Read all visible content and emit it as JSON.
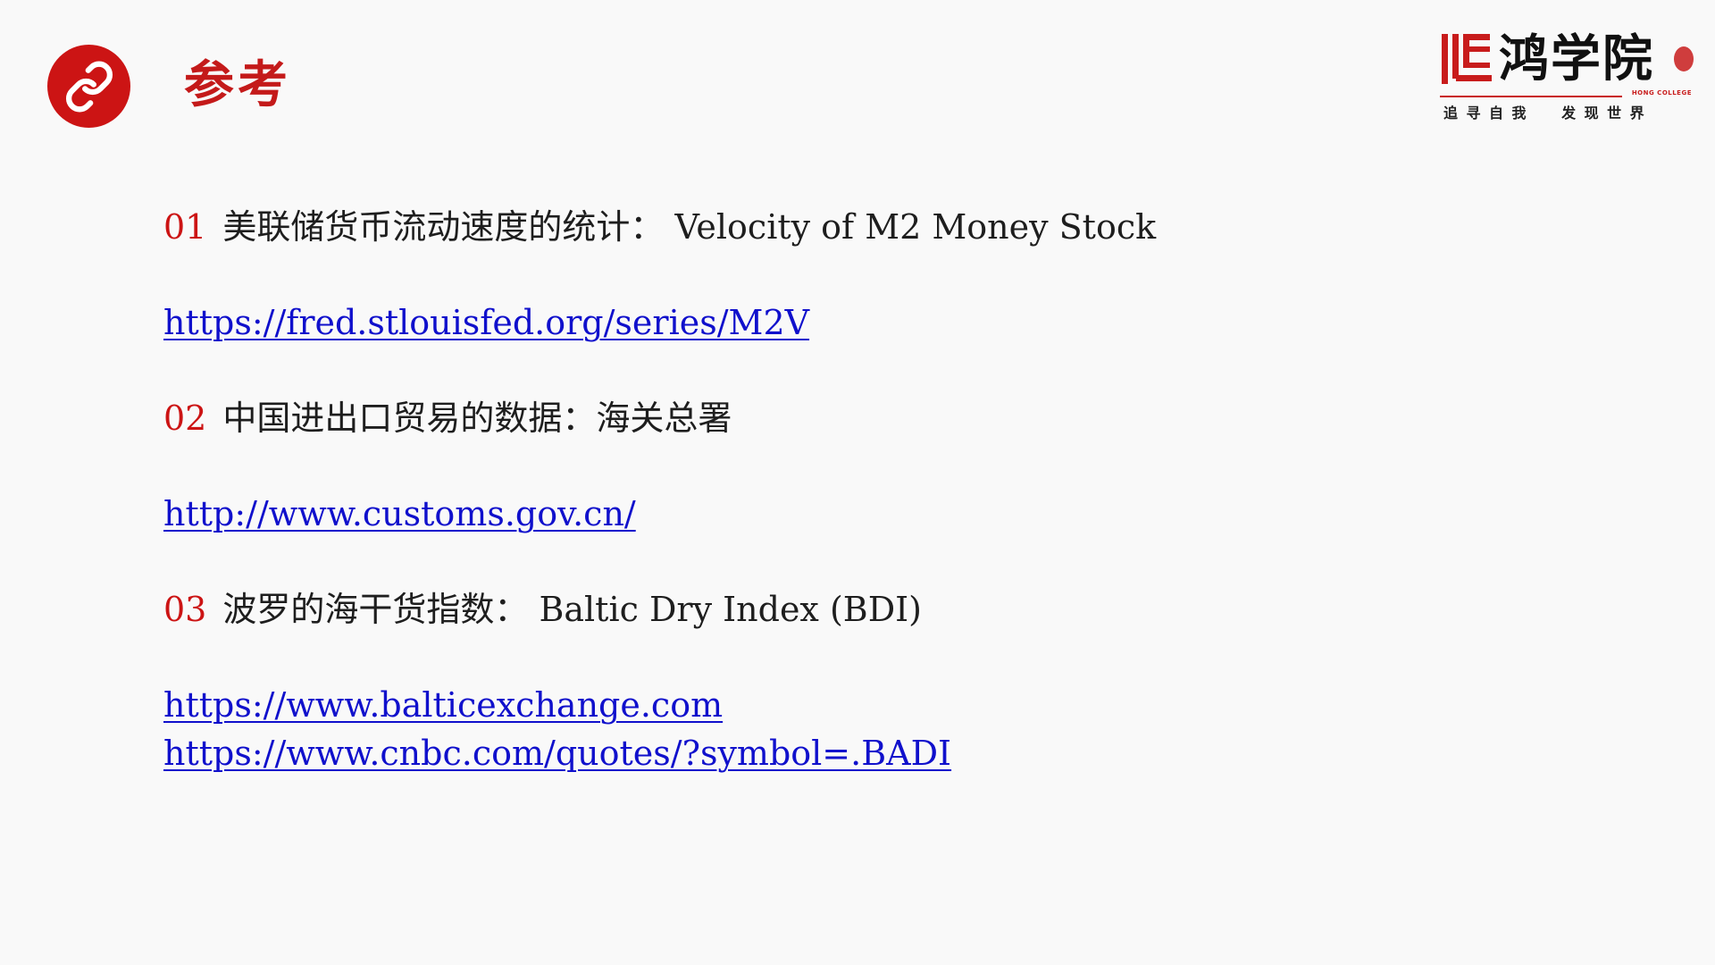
{
  "header": {
    "title": "参考",
    "link_icon": "link-icon"
  },
  "logo": {
    "name": "鸿学院",
    "english": "HONG COLLEGE",
    "slogan": "追寻自我  发现世界"
  },
  "references": [
    {
      "number": "01",
      "description": "美联储货币流动速度的统计： Velocity of M2 Money Stock",
      "links": [
        "https://fred.stlouisfed.org/series/M2V"
      ]
    },
    {
      "number": "02",
      "description": "中国进出口贸易的数据：海关总署",
      "links": [
        "http://www.customs.gov.cn/"
      ]
    },
    {
      "number": "03",
      "description": "波罗的海干货指数： Baltic Dry Index (BDI)",
      "links": [
        "https://www.balticexchange.com",
        "https://www.cnbc.com/quotes/?symbol=.BADI"
      ]
    }
  ],
  "colors": {
    "accent": "#cc1414",
    "link": "#1010cc",
    "background": "#f9f9f9"
  }
}
